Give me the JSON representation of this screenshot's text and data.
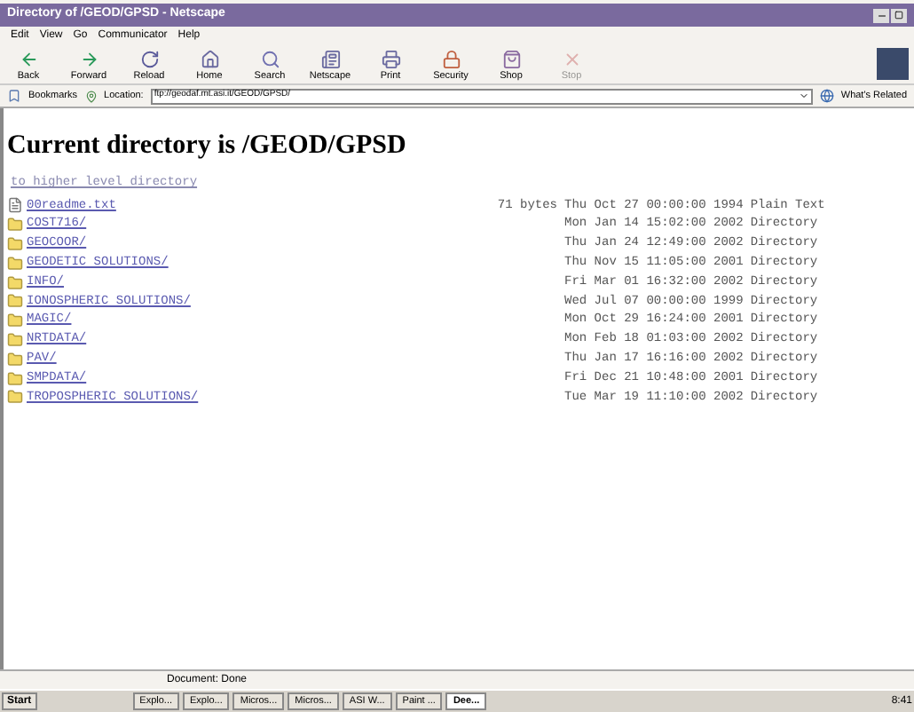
{
  "window": {
    "title": "Directory of /GEOD/GPSD - Netscape"
  },
  "menu": [
    "Edit",
    "View",
    "Go",
    "Communicator",
    "Help"
  ],
  "toolbar": [
    {
      "kind": "back",
      "label": "Back"
    },
    {
      "kind": "forward",
      "label": "Forward"
    },
    {
      "kind": "reload",
      "label": "Reload"
    },
    {
      "kind": "home",
      "label": "Home"
    },
    {
      "kind": "search",
      "label": "Search"
    },
    {
      "kind": "netscape",
      "label": "Netscape"
    },
    {
      "kind": "print",
      "label": "Print"
    },
    {
      "kind": "security",
      "label": "Security"
    },
    {
      "kind": "shop",
      "label": "Shop"
    },
    {
      "kind": "stop",
      "label": "Stop"
    }
  ],
  "location": {
    "bookmarks": "Bookmarks",
    "label": "Location:",
    "value": "ftp://geodaf.mt.asi.it/GEOD/GPSD/",
    "related": "What's Related"
  },
  "page": {
    "heading": "Current directory is /GEOD/GPSD",
    "up_link": "to higher level directory",
    "entries": [
      {
        "kind": "file",
        "name": "00readme.txt",
        "size": "71 bytes",
        "date": "Thu Oct 27 00:00:00 1994",
        "type": "Plain Text"
      },
      {
        "kind": "folder",
        "name": "COST716/",
        "date": "Mon Jan 14 15:02:00 2002",
        "type": "Directory"
      },
      {
        "kind": "folder",
        "name": "GEOCOOR/",
        "date": "Thu Jan 24 12:49:00 2002",
        "type": "Directory"
      },
      {
        "kind": "folder",
        "name": "GEODETIC SOLUTIONS/",
        "date": "Thu Nov 15 11:05:00 2001",
        "type": "Directory"
      },
      {
        "kind": "folder",
        "name": "INFO/",
        "date": "Fri Mar 01 16:32:00 2002",
        "type": "Directory"
      },
      {
        "kind": "folder",
        "name": "IONOSPHERIC SOLUTIONS/",
        "date": "Wed Jul 07 00:00:00 1999",
        "type": "Directory"
      },
      {
        "kind": "folder",
        "name": "MAGIC/",
        "date": "Mon Oct 29 16:24:00 2001",
        "type": "Directory"
      },
      {
        "kind": "folder",
        "name": "NRTDATA/",
        "date": "Mon Feb 18 01:03:00 2002",
        "type": "Directory"
      },
      {
        "kind": "folder",
        "name": "PAV/",
        "date": "Thu Jan 17 16:16:00 2002",
        "type": "Directory"
      },
      {
        "kind": "folder",
        "name": "SMPDATA/",
        "date": "Fri Dec 21 10:48:00 2001",
        "type": "Directory"
      },
      {
        "kind": "folder",
        "name": "TROPOSPHERIC SOLUTIONS/",
        "date": "Tue Mar 19 11:10:00 2002",
        "type": "Directory"
      }
    ]
  },
  "status_bar": "Document: Done",
  "taskbar": {
    "start": "Start",
    "tasks": [
      {
        "label": "Explo...",
        "selected": false
      },
      {
        "label": "Explo...",
        "selected": false
      },
      {
        "label": "Micros...",
        "selected": false
      },
      {
        "label": "Micros...",
        "selected": false
      },
      {
        "label": "ASI W...",
        "selected": false
      },
      {
        "label": "Paint ...",
        "selected": false
      },
      {
        "label": "Dee...",
        "selected": true
      }
    ],
    "clock": "8:41"
  }
}
